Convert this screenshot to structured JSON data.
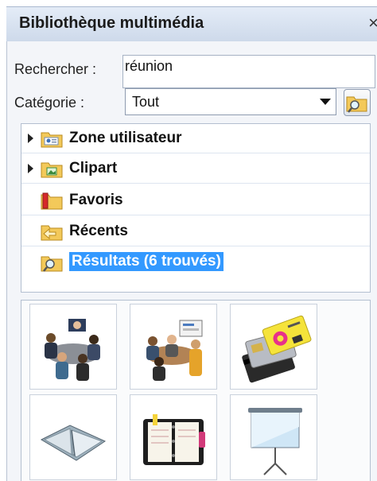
{
  "panel": {
    "title": "Bibliothèque multimédia",
    "close_glyph": "×"
  },
  "search": {
    "label": "Rechercher :",
    "value": "réunion"
  },
  "category": {
    "label": "Catégorie :",
    "selected": "Tout"
  },
  "tree": {
    "items": [
      {
        "label": "Zone utilisateur",
        "icon": "user-folder-icon",
        "expandable": true,
        "selected": false
      },
      {
        "label": "Clipart",
        "icon": "clipart-folder-icon",
        "expandable": true,
        "selected": false
      },
      {
        "label": "Favoris",
        "icon": "favorites-folder-icon",
        "expandable": false,
        "selected": false
      },
      {
        "label": "Récents",
        "icon": "recent-folder-icon",
        "expandable": false,
        "selected": false
      },
      {
        "label": "Résultats (6 trouvés)",
        "icon": "search-results-folder-icon",
        "expandable": false,
        "selected": true
      }
    ]
  },
  "colors": {
    "selection": "#3399ff",
    "titlebar": "#d6e1f0",
    "folder": "#f3c95a"
  },
  "results": [
    {
      "icon": "meeting-people-icon"
    },
    {
      "icon": "meeting-presentation-icon"
    },
    {
      "icon": "access-cards-icon"
    },
    {
      "icon": "open-book-icon"
    },
    {
      "icon": "organizer-agenda-icon"
    },
    {
      "icon": "projection-screen-icon"
    }
  ]
}
